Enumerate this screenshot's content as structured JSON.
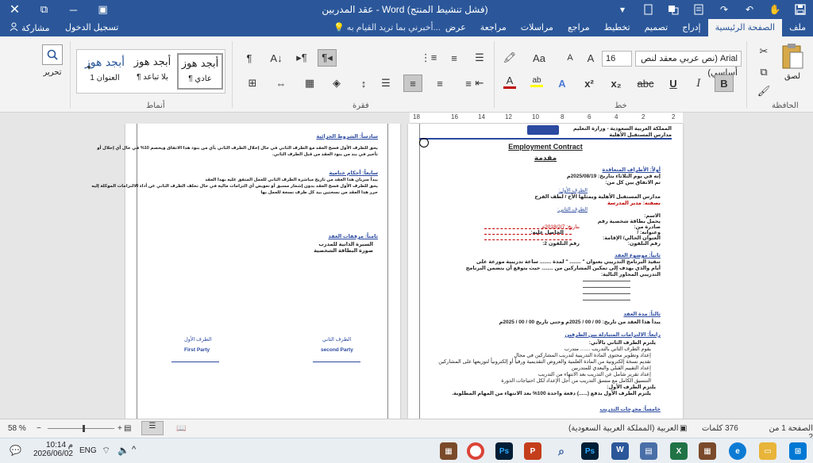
{
  "title_bar": {
    "title": "عقد المدربين - Word (فشل تنشيط المنتج)",
    "close_glyph": "✕",
    "restore_glyph": "⧉",
    "minimize_glyph": "─",
    "ribbon_display_glyph": "▣"
  },
  "tabs": [
    "ملف",
    "الصفحة الرئيسية",
    "إدراج",
    "تصميم",
    "تخطيط",
    "مراجع",
    "مراسلات",
    "مراجعة",
    "عرض"
  ],
  "active_tab": "الصفحة الرئيسية",
  "tell_me": "أخبرني بما تريد القيام به...",
  "sign_in": "تسجيل الدخول",
  "share": "مشاركة",
  "ribbon": {
    "clipboard_label": "الحافظة",
    "paste_label": "لصق",
    "font_group_label": "خط",
    "font_name": "Arial (نص عربي معقد لنص أساسي)",
    "font_size": "16",
    "paragraph_label": "فقرة",
    "styles_label": "أنماط",
    "styles": [
      {
        "preview": "أبجد هوز",
        "name": "¶ عادي"
      },
      {
        "preview": "أبجد هوز",
        "name": "¶ بلا تباعد"
      },
      {
        "preview": "أبجد هوز",
        "name": "العنوان 1"
      }
    ],
    "editing_label": "تحرير",
    "bold": "B",
    "italic": "I",
    "underline": "U",
    "strike": "abc",
    "sub": "x₂",
    "sup": "x²",
    "font_color": "A",
    "highlight": "ab",
    "grow": "A",
    "shrink": "A",
    "change_case": "Aa"
  },
  "ruler_ticks": [
    "18",
    "16",
    "14",
    "12",
    "10",
    "8",
    "6",
    "4",
    "2",
    "2"
  ],
  "page_right": {
    "org1": "المملكة العربية السعودية - وزارة التعليم",
    "org2": "مدارس المستقبل الأهلية",
    "title_en": "Employment Contract",
    "title_ar": "مقدمة",
    "s1": "أولاً: الأطراف المتعاقدة",
    "s1_l1": "إنه في يوم الثلاثاء بتاريخ: 2025/08/19م",
    "s1_l2": "تم الاتفاق بين كل من:",
    "s1_l3": "مدارس المستقبل الأهلية ويمثلها الأخ / لطف الفرح",
    "s1_l4": "بصفته: مدير المدرسة",
    "s1_l5": "الطرف الأول:",
    "s1_l6": "الطرف الثاني:",
    "f1": "الاسم:",
    "f2": "يحمل بطاقة شخصية رقم",
    "f3": "صادرة من:",
    "f3b": "بتاريخ: 2018/2/7م",
    "f4": "وعنوانه: /",
    "f4b": "الحاصل عليه:",
    "f5": "العنوان الحالي/ الإقامة:",
    "f6": "رقم التلفون:",
    "f6b": "رقم التلفون 2:",
    "s2": "ثانياً: موضوع العقد",
    "s2_l1": "تنفيذ البرنامج التدريبي بعنوان \" ........ \" لمدة ........ ساعة تدريبية موزعة على",
    "s2_l2": "أيام والذي يهدف إلى تمكين المشاركين من ........ حيث يتوقع أن يتضمن البرنامج",
    "s2_l3": "التدريبي المحاور التالية:",
    "s3": "ثالثاً: مدة العقد",
    "s3_l1": "يبدأ هذا العقد من تاريخ: 00 / 00 / 2025م وحتى تاريخ 00 / 00 / 2025م",
    "s4": "رابعاً: الالتزامات المتبادلة بين الطرفين",
    "s4_l0": "يلتزم الطرف الثاني بالآتي:",
    "s4_items": [
      "يقوم الطرف الثاني بالتدريب ....... متدرب",
      "إعداد وتطوير محتوى المادة التدريبية لتدريب المشاركين في مجال",
      "تقديم نسخة إلكترونية من المادة العلمية والعروض التقديمية ورقياً أو إلكترونياً لتوزيعها على المشاركين",
      "إعداد التقييم القبلي والبعدي للمتدربين",
      "إعداد تقرير شامل عن التدريب بعد الانتهاء من التدريب",
      "التنسيق الكامل مع منسق التدريب من أجل الإعداد لكل احتياجات الدورة"
    ],
    "s4_l7": "يلتزم الطرف الأول:",
    "s4_l8": "يلتزم الطرف الأول بدفع (......) دفعة واحدة 100% بعد الانتهاء من المهام المطلوبة.",
    "s5": "خامساً: مخرجات التدريب"
  },
  "page_left": {
    "s6": "سادساً: الشروط الجزائية",
    "s6_l1": "يحق للطرف الأول فسخ العقد مع الطرف الثاني في حال إخلال الطرف الثاني بأي من بنود هذا الاتفاق ويخصم 10% في حال أي إخلال أو",
    "s6_l2": "تأخير في بند من بنود العقد من قبل الطرف الثاني.",
    "s7": "سابعاً: أحكام ختامية",
    "s7_l1": "يبدأ سريان هذا العقد من تاريخ مباشرة الطرف الثاني للعمل المتفق عليه بهذا العقد",
    "s7_l2": "يحق للطرف الأول فسخ العقد بدون إشعار مسبق أو تعويض أي التزامات مالية في حال تخلف الطرف الثاني عن أداء الالتزامات الموكلة إليه",
    "s7_l3": "حرر هذا العقد من نسختين بيد كل طرف نسخة للعمل بها",
    "s8": "ثامناً: مرفقات العقد",
    "s8_items": [
      "السيرة الذاتية للمدرب",
      "صورة البطاقة الشخصية"
    ],
    "sig_first_ar": "الطرف الأول",
    "sig_first_en": "First Party",
    "sig_second_ar": "الطرف الثاني",
    "sig_second_en": "second Party"
  },
  "status": {
    "page": "الصفحة 1 من 2",
    "words": "376 كلمات",
    "language": "العربية (المملكة العربية السعودية)",
    "zoom": "58 %"
  },
  "taskbar": {
    "time": "10:14 م",
    "date": "2026/06/02",
    "lang": "ENG"
  },
  "colors": {
    "word_blue": "#2b579a",
    "ribbon_bg": "#f3f3f3",
    "doc_bg": "#e6e6e6",
    "heading_blue": "#2b4aa0",
    "red": "#c00000"
  }
}
